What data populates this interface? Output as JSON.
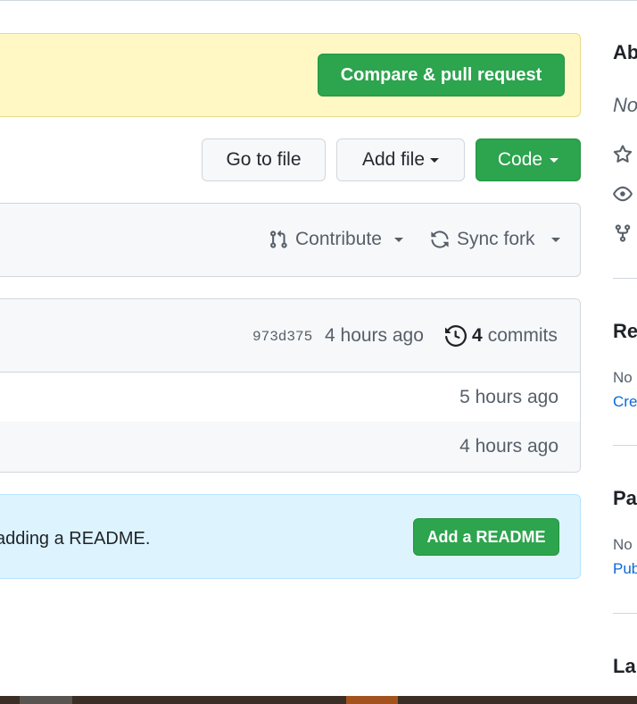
{
  "banner": {
    "compare_label": "Compare & pull request"
  },
  "actions": {
    "go_to_file": "Go to file",
    "add_file": "Add file",
    "code": "Code"
  },
  "fork_bar": {
    "contribute": "Contribute",
    "sync_fork": "Sync fork"
  },
  "latest_commit": {
    "sha": "973d375",
    "time": "4 hours ago",
    "commit_count": "4",
    "commits_label": "commits"
  },
  "files": [
    {
      "time": "5 hours ago"
    },
    {
      "time": "4 hours ago"
    }
  ],
  "readme_banner": {
    "text": "adding a README.",
    "button": "Add a README"
  },
  "sidebar": {
    "about_heading": "Ab",
    "about_desc": "No",
    "releases_heading": "Re",
    "releases_text": "No",
    "releases_link": "Cre",
    "packages_heading": "Pa",
    "packages_text": "No",
    "packages_link": "Pub",
    "languages_heading": "La"
  },
  "colors": {
    "primary_green": "#2da44e",
    "flash_yellow": "#fff8c5",
    "info_blue": "#ddf4ff",
    "link_blue": "#0969da"
  },
  "icons": [
    "git-pull-request-icon",
    "sync-icon",
    "history-icon",
    "star-icon",
    "eye-icon",
    "repo-forked-icon"
  ]
}
